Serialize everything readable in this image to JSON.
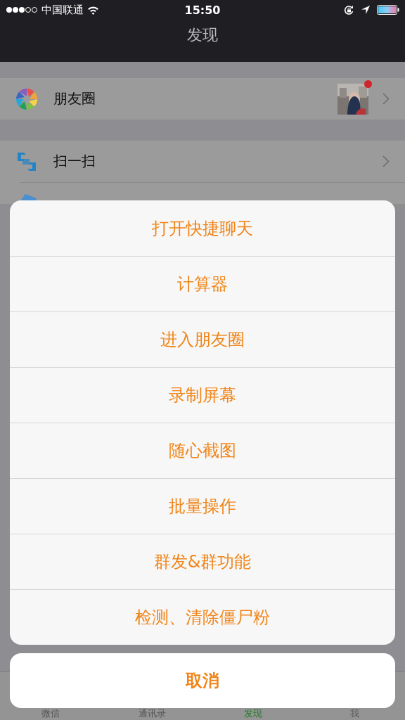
{
  "status_bar": {
    "carrier": "中国联通",
    "time": "15:50"
  },
  "nav": {
    "title": "发现"
  },
  "sections": [
    {
      "items": [
        {
          "kind": "moments",
          "label": "朋友圈",
          "thumbnail": {
            "kind": "picture",
            "unread": true
          }
        }
      ]
    },
    {
      "items": [
        {
          "kind": "scan",
          "label": "扫一扫"
        },
        {
          "kind": "shake"
        }
      ]
    }
  ],
  "tabs": [
    {
      "label": "微信",
      "selected": false
    },
    {
      "label": "通讯录",
      "selected": false
    },
    {
      "label": "发现",
      "selected": true
    },
    {
      "label": "我",
      "selected": false
    }
  ],
  "sheet": {
    "actions": [
      "打开快捷聊天",
      "计算器",
      "进入朋友圈",
      "录制屏幕",
      "随心截图",
      "批量操作",
      "群发&群功能",
      "检测、清除僵尸粉"
    ],
    "cancel": "取消"
  }
}
